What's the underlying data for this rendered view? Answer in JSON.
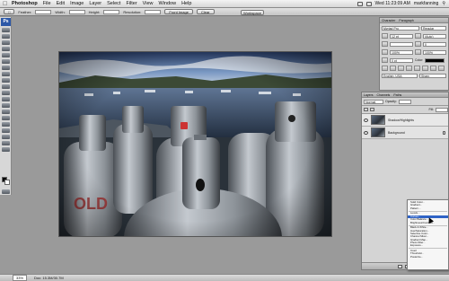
{
  "menubar": {
    "app": "Photoshop",
    "items": [
      "File",
      "Edit",
      "Image",
      "Layer",
      "Select",
      "Filter",
      "View",
      "Window",
      "Help"
    ],
    "clock": "Wed 11:23:09 AM",
    "user": "markfanning"
  },
  "options": {
    "feather_label": "Feather:",
    "width_label": "Width:",
    "height_label": "Height:",
    "resolution_label": "Resolution:",
    "front_image": "Front Image",
    "clear": "Clear",
    "workspace": "Workspace"
  },
  "character": {
    "tabs": [
      "Character",
      "Paragraph"
    ],
    "font": "Myriad Pro",
    "font_style": "Regular",
    "size": "12 pt",
    "leading": "(Auto)",
    "tracking": "0",
    "scale_v": "100%",
    "scale_h": "100%",
    "baseline": "0 pt",
    "color_label": "Color:",
    "language": "English: USA",
    "aa": "Sharp"
  },
  "layers": {
    "tabs": [
      "Layers",
      "Channels",
      "Paths"
    ],
    "blend_mode": "Normal",
    "opacity_label": "Opacity:",
    "fill_label": "Fill:",
    "rows": [
      {
        "name": "Shadow/Highlights"
      },
      {
        "name": "Background"
      }
    ]
  },
  "adjustment_menu": {
    "items": [
      {
        "label": "Solid Color...",
        "hl": false
      },
      {
        "label": "Gradient...",
        "hl": false
      },
      {
        "label": "Pattern...",
        "hl": false
      },
      {
        "sep": true
      },
      {
        "label": "Levels...",
        "hl": false
      },
      {
        "label": "Curves...",
        "hl": true
      },
      {
        "label": "Color Balance...",
        "hl": false
      },
      {
        "label": "Brightness/Contrast...",
        "hl": false
      },
      {
        "sep": true
      },
      {
        "label": "Black & White...",
        "hl": false
      },
      {
        "label": "Hue/Saturation...",
        "hl": false
      },
      {
        "label": "Selective Color...",
        "hl": false
      },
      {
        "label": "Channel Mixer...",
        "hl": false
      },
      {
        "label": "Gradient Map...",
        "hl": false
      },
      {
        "label": "Photo Filter...",
        "hl": false
      },
      {
        "label": "Exposure...",
        "hl": false
      },
      {
        "sep": true
      },
      {
        "label": "Invert",
        "hl": false
      },
      {
        "label": "Threshold...",
        "hl": false
      },
      {
        "label": "Posterize...",
        "hl": false
      }
    ]
  },
  "status": {
    "zoom": "33%",
    "doc": "Doc: 15.3M/30.7M"
  },
  "colors": {
    "accent": "#2f63c6",
    "canvas_bg": "#9a9a9a"
  }
}
